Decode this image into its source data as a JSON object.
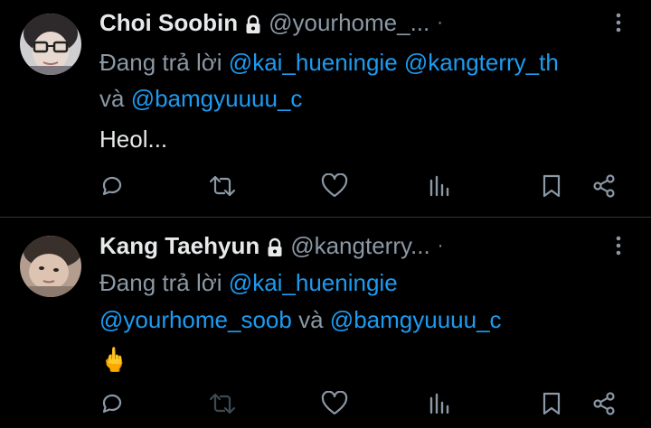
{
  "tweets": [
    {
      "display_name": "Choi Soobin",
      "handle": "@yourhome_...",
      "separator": "·",
      "reply_prefix": "Đang trả lời",
      "reply_mentions": [
        "@kai_hueningie",
        "@kangterry_th",
        "@bamgyuuuu_c"
      ],
      "reply_joiner": "và",
      "body": "Heol..."
    },
    {
      "display_name": "Kang Taehyun",
      "handle": "@kangterry...",
      "separator": "·",
      "reply_prefix": "Đang trả lời",
      "reply_mentions": [
        "@kai_hueningie",
        "@yourhome_soob",
        "@bamgyuuuu_c"
      ],
      "reply_joiner": "và",
      "body": "🖕"
    }
  ],
  "actions": [
    "reply-icon",
    "retweet-icon",
    "like-icon",
    "views-icon",
    "bookmark-icon",
    "share-icon"
  ],
  "colors": {
    "background": "#000000",
    "text_primary": "#e7e9ea",
    "text_secondary": "#8b98a5",
    "link": "#1d9bf0",
    "divider": "#2f3336"
  }
}
